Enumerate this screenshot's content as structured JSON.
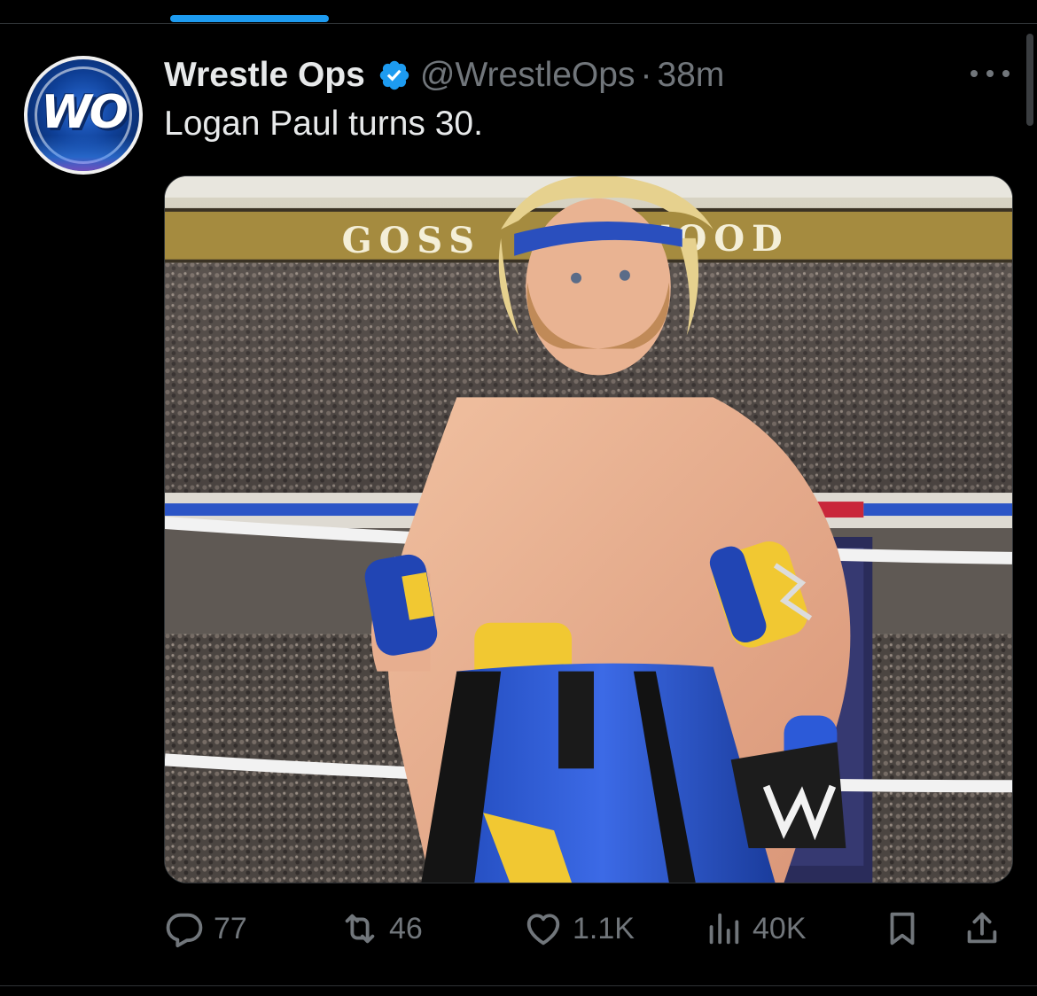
{
  "tweet": {
    "author_name": "Wrestle Ops",
    "handle": "@WrestleOps",
    "separator": "·",
    "time": "38m",
    "text": "Logan Paul turns 30.",
    "avatar_text": "WO"
  },
  "media": {
    "banner_text": "GOSS",
    "banner_text_right": "WOOD"
  },
  "actions": {
    "replies": "77",
    "reposts": "46",
    "likes": "1.1K",
    "views": "40K"
  },
  "colors": {
    "accent": "#1d9bf0",
    "muted": "#71767b",
    "text": "#e7e9ea",
    "background": "#000000"
  },
  "icons": [
    "verified-badge-icon",
    "more-icon",
    "reply-icon",
    "repost-icon",
    "like-icon",
    "views-icon",
    "bookmark-icon",
    "share-icon"
  ]
}
